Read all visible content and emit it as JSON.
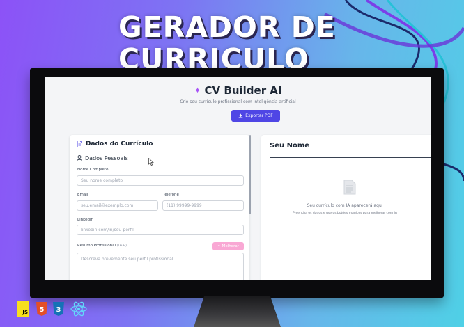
{
  "hero": {
    "line1": "GERADOR DE",
    "line2": "CURRICULO"
  },
  "app": {
    "name": "CV Builder AI",
    "subtitle": "Crie seu currículo profissional com inteligência artificial",
    "export_label": "Exportar PDF"
  },
  "form": {
    "title": "Dados do Currículo",
    "section_personal": "Dados Pessoais",
    "name_label": "Nome Completo",
    "name_placeholder": "Seu nome completo",
    "email_label": "Email",
    "email_placeholder": "seu.email@exemplo.com",
    "phone_label": "Telefone",
    "phone_placeholder": "(11) 99999-9999",
    "linkedin_label": "LinkedIn",
    "linkedin_placeholder": "linkedin.com/in/seu-perfil",
    "summary_label": "Resumo Profissional",
    "summary_optional": "(IA+)",
    "improve_label": "Melhorar",
    "summary_placeholder": "Descreva brevemente seu perfil profissional..."
  },
  "preview": {
    "name": "Seu Nome",
    "empty_message": "Seu currículo com IA aparecerá aqui",
    "empty_hint": "Preencha os dados e use os botões mágicos para melhorar com IA"
  },
  "tech_icons": [
    "js-logo-icon",
    "html5-logo-icon",
    "css3-logo-icon",
    "react-logo-icon"
  ],
  "tech": {
    "js": "JS",
    "html": "5",
    "css": "3"
  },
  "colors": {
    "accent": "#4f46e5",
    "ai_button": "#f9a8d4",
    "sparkle": "#a855f7"
  }
}
